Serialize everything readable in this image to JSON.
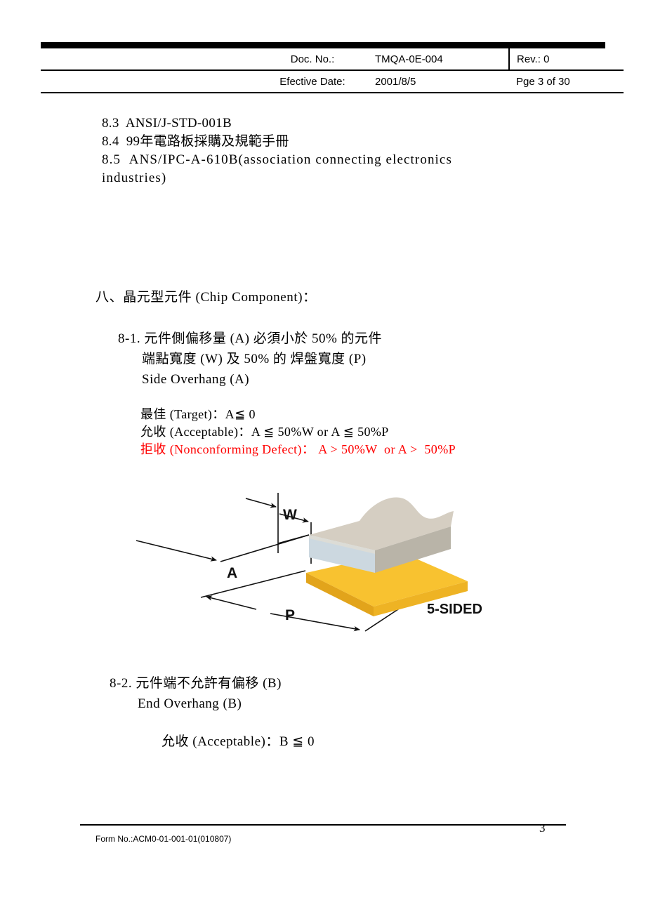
{
  "header": {
    "doc_no_label": "Doc. No.:",
    "doc_no_value": "TMQA-0E-004",
    "rev_label": "Rev.: 0",
    "effective_date_label": "Efective Date:",
    "effective_date_value": "2001/8/5",
    "page_label": "Pge 3 of 30"
  },
  "references": {
    "item_83": "8.3  ANSI/J-STD-001B",
    "item_84": "8.4  99年電路板採購及規範手冊",
    "item_85_line1": "8.5  ANS/IPC-A-610B(association connecting electronics",
    "item_85_line2": "industries)"
  },
  "section": {
    "heading": "八、晶元型元件 (Chip Component)："
  },
  "clause_81": {
    "line1": "8-1. 元件側偏移量 (A) 必須小於 50% 的元件",
    "line2": "端點寬度 (W) 及 50% 的 焊盤寬度 (P)",
    "line3": "Side Overhang (A)",
    "criteria_target": "最佳 (Target)：A≦ 0",
    "criteria_acceptable": "允收 (Acceptable)：A ≦ 50%W or A ≦ 50%P",
    "criteria_reject": "拒收 (Nonconforming Defect)： A > 50%W  or A >  50%P",
    "reject_color": "#ff0000"
  },
  "figure": {
    "label_w": "W",
    "label_a": "A",
    "label_p": "P",
    "label_type": "5-SIDED",
    "colors": {
      "chip_top": "#d5cec2",
      "chip_front": "#ccd8e0",
      "chip_side": "#b9b4a8",
      "pad_top": "#f8c230",
      "pad_edge": "#e8a81c"
    }
  },
  "clause_82": {
    "line1": "8-2. 元件端不允許有偏移 (B)",
    "line2": "End Overhang (B)",
    "criteria_acceptable": "允收 (Acceptable)：B ≦ 0"
  },
  "footer": {
    "page_number": "3",
    "form_no": "Form No.:ACM0-01-001-01(010807)"
  }
}
